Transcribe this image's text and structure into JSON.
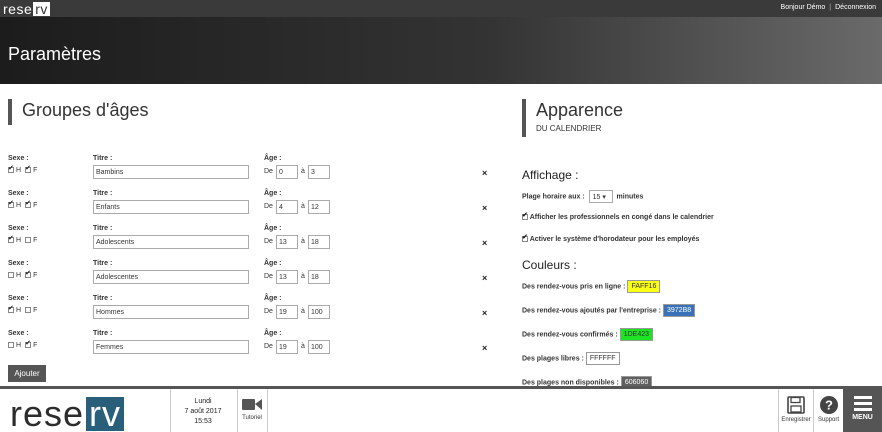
{
  "topbar": {
    "logo_text": "rese",
    "logo_accent": "rv",
    "greeting": "Bonjour Démo",
    "separator": "|",
    "logout": "Déconnexion"
  },
  "header": {
    "title": "Paramètres"
  },
  "age_groups": {
    "title": "Groupes d'âges",
    "sex_label": "Sexe :",
    "title_label": "Titre :",
    "age_label": "Âge :",
    "from_label": "De",
    "to_label": "à",
    "h_label": "H",
    "f_label": "F",
    "delete_icon": "×",
    "rows": [
      {
        "h": true,
        "f": true,
        "title": "Bambins",
        "from": "0",
        "to": "3"
      },
      {
        "h": true,
        "f": true,
        "title": "Enfants",
        "from": "4",
        "to": "12"
      },
      {
        "h": true,
        "f": false,
        "title": "Adolescents",
        "from": "13",
        "to": "18"
      },
      {
        "h": false,
        "f": true,
        "title": "Adolescentes",
        "from": "13",
        "to": "18"
      },
      {
        "h": true,
        "f": false,
        "title": "Hommes",
        "from": "19",
        "to": "100"
      },
      {
        "h": false,
        "f": true,
        "title": "Femmes",
        "from": "19",
        "to": "100"
      }
    ],
    "add_button": "Ajouter"
  },
  "appearance": {
    "title": "Apparence",
    "subtitle": "DU CALENDRIER",
    "display_title": "Affichage :",
    "time_slot_label": "Plage horaire aux :",
    "time_slot_value": "15",
    "time_slot_unit": "minutes",
    "show_leave": {
      "checked": true,
      "label": "Afficher les professionnels en congé dans le calendrier"
    },
    "timeclock": {
      "checked": true,
      "label": "Activer le système d'horodateur pour les employés"
    },
    "colors_title": "Couleurs :",
    "colors": [
      {
        "label": "Des rendez-vous pris en ligne :",
        "value": "FAFF16",
        "bg": "#FAFF16",
        "fg": "#333333"
      },
      {
        "label": "Des rendez-vous ajoutés par l'entreprise :",
        "value": "3972B8",
        "bg": "#3972B8",
        "fg": "#ffffff"
      },
      {
        "label": "Des rendez-vous confirmés :",
        "value": "1DE423",
        "bg": "#1DE423",
        "fg": "#333333"
      },
      {
        "label": "Des plages libres :",
        "value": "FFFFFF",
        "bg": "#FFFFFF",
        "fg": "#333333"
      },
      {
        "label": "Des plages non disponibles :",
        "value": "606060",
        "bg": "#606060",
        "fg": "#ffffff"
      }
    ]
  },
  "footer": {
    "logo_text": "rese",
    "logo_accent": "rv",
    "day": "Lundi",
    "date": "7 août 2017",
    "time": "15:53",
    "tutorial": "Tutoriel",
    "save": "Enregistrer",
    "support": "Support",
    "menu": "MENU"
  }
}
